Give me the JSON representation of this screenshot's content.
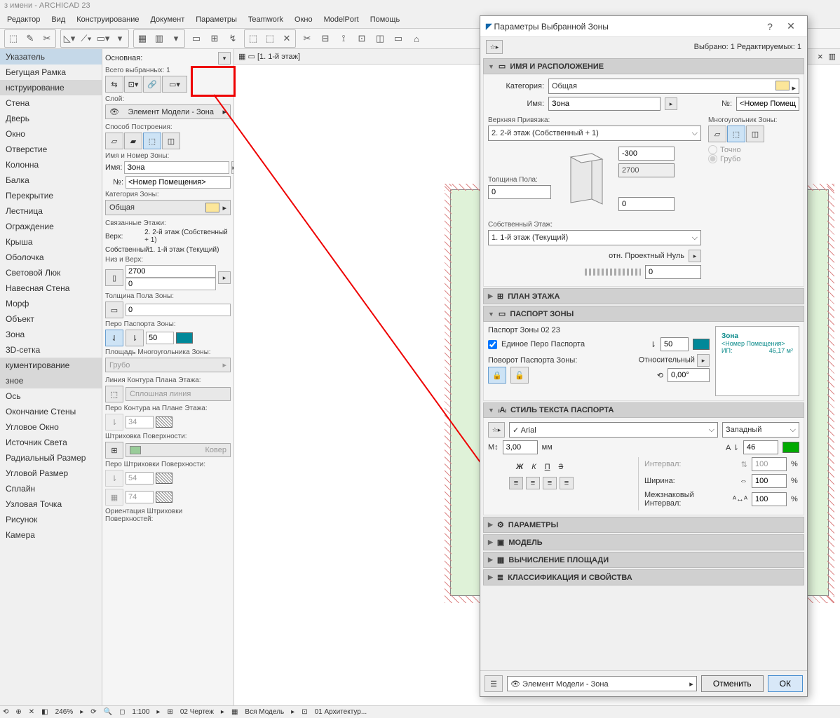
{
  "app": {
    "title": "з имени - ARCHICAD 23"
  },
  "menu": [
    "Редактор",
    "Вид",
    "Конструирование",
    "Документ",
    "Параметры",
    "Teamwork",
    "Окно",
    "ModelPort",
    "Помощь"
  ],
  "left_panel": {
    "items": [
      {
        "label": "Указатель",
        "active": true
      },
      {
        "label": "Бегущая Рамка"
      }
    ],
    "group1_header": "нструирование",
    "group1": [
      "Стена",
      "Дверь",
      "Окно",
      "Отверстие",
      "Колонна",
      "Балка",
      "Перекрытие",
      "Лестница",
      "Ограждение",
      "Крыша",
      "Оболочка",
      "Световой Люк",
      "Навесная Стена",
      "Морф",
      "Объект",
      "Зона",
      "3D-сетка"
    ],
    "group2_header": "кументирование",
    "group3_header": "зное",
    "group3": [
      "Ось",
      "Окончание Стены",
      "Угловое Окно",
      "Источник Света",
      "Радиальный Размер",
      "Угловой Размер",
      "Сплайн",
      "Узловая Точка",
      "Рисунок",
      "Камера"
    ]
  },
  "info_box": {
    "header": "Основная:",
    "selected": "Всего выбранных: 1",
    "layer_label": "Слой:",
    "layer_value": "Элемент Модели - Зона",
    "construct_label": "Способ Построения:",
    "name_section": "Имя и Номер Зоны:",
    "name_label": "Имя:",
    "name_value": "Зона",
    "number_label": "№:",
    "number_value": "<Номер Помещения>",
    "category_label": "Категория Зоны:",
    "category_value": "Общая",
    "linked_label": "Связанные Этажи:",
    "linked_top_label": "Верх:",
    "linked_top_value": "2. 2-й этаж (Собственный + 1)",
    "linked_own_label": "Собственный:",
    "linked_own_value": "1. 1-й этаж (Текущий)",
    "bottom_top_label": "Низ и Верх:",
    "height_top": "2700",
    "height_bottom": "0",
    "floor_thick_label": "Толщина Пола Зоны:",
    "floor_thick_value": "0",
    "stamp_pen_label": "Перо Паспорта Зоны:",
    "stamp_pen_value": "50",
    "poly_area_label": "Площадь Многоугольника Зоны:",
    "poly_area_value": "Грубо",
    "outline_label": "Линия Контура Плана Этажа:",
    "outline_value": "Сплошная линия",
    "outline_pen_label": "Перо Контура на Плане Этажа:",
    "outline_pen_value": "34",
    "hatch_label": "Штриховка Поверхности:",
    "hatch_value": "Ковер",
    "hatch_pen_label": "Перо Штриховки Поверхности:",
    "hatch_pen1": "54",
    "hatch_pen2": "74",
    "hatch_orient_label": "Ориентация Штриховки Поверхностей:"
  },
  "doc_tab": {
    "label": "[1. 1-й этаж]"
  },
  "dialog": {
    "title": "Параметры Выбранной Зоны",
    "sub": "Выбрано: 1 Редактируемых: 1",
    "sec_name": "ИМЯ И РАСПОЛОЖЕНИЕ",
    "cat_label": "Категория:",
    "cat_value": "Общая",
    "name_label": "Имя:",
    "name_value": "Зона",
    "num_label": "№:",
    "num_value": "<Номер Помещ",
    "top_link_label": "Верхняя Привязка:",
    "top_link_value": "2. 2-й этаж (Собственный + 1)",
    "poly_label": "Многоугольник Зоны:",
    "poly_exact": "Точно",
    "poly_rough": "Грубо",
    "offset_top": "-300",
    "height_val": "2700",
    "floor_label": "Толщина Пола:",
    "floor_value": "0",
    "offset_bottom": "0",
    "own_story_label": "Собственный Этаж:",
    "own_story_value": "1. 1-й этаж (Текущий)",
    "proj_zero_label": "отн. Проектный Нуль",
    "proj_zero_value": "0",
    "sec_floorplan": "ПЛАН ЭТАЖА",
    "sec_stamp": "ПАСПОРТ ЗОНЫ",
    "stamp_name": "Паспорт Зоны 02 23",
    "single_pen_label": "Единое Перо Паспорта",
    "single_pen_value": "50",
    "rotate_label": "Поворот Паспорта Зоны:",
    "relative_label": "Относительный",
    "angle_value": "0,00°",
    "preview_zone": "Зона",
    "preview_num": "<Номер Помещения>",
    "preview_area_label": "ИП:",
    "preview_area_value": "46,17 м²",
    "sec_text_style": "СТИЛЬ ТЕКСТА ПАСПОРТА",
    "font_value": "Arial",
    "encoding_value": "Западный",
    "text_size": "3,00",
    "text_size_unit": "мм",
    "pen_text": "46",
    "bold": "Ж",
    "italic": "К",
    "underline": "П",
    "strike": "З",
    "interval_label": "Интервал:",
    "interval_value": "100",
    "width_label": "Ширина:",
    "width_value": "100",
    "char_space_label": "Межзнаковый Интервал:",
    "char_space_value": "100",
    "sec_params": "ПАРАМЕТРЫ",
    "sec_model": "МОДЕЛЬ",
    "sec_area": "ВЫЧИСЛЕНИЕ ПЛОЩАДИ",
    "sec_class": "КЛАССИФИКАЦИЯ И СВОЙСТВА",
    "footer_layer": "Элемент Модели - Зона",
    "btn_cancel": "Отменить",
    "btn_ok": "ОК"
  },
  "status": {
    "zoom": "246%",
    "scale": "1:100",
    "view": "02 Чертеж",
    "model": "Вся Модель",
    "arch": "01 Архитектур..."
  }
}
